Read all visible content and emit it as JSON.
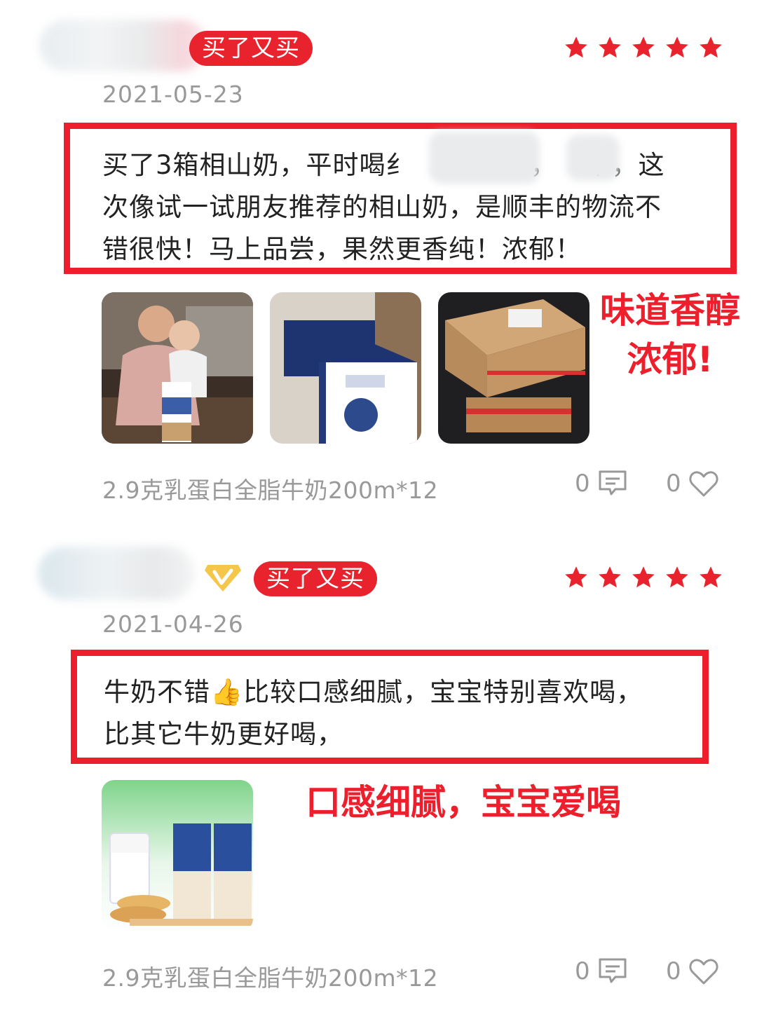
{
  "reviews": [
    {
      "badge": "买了又买",
      "rating": 5,
      "date": "2021-05-23",
      "text_lines": [
        "买了3箱相山奶，平时喝纟",
        "次像试一试朋友推荐的相山奶，是顺丰的物流不",
        "错很快！马上品尝，果然更香纯！浓郁！"
      ],
      "text_line1_mid": "利，",
      "text_line1_end": "丰，这",
      "callout_lines": [
        "味道香醇",
        "浓郁!"
      ],
      "images": [
        "grandma-and-baby-photo",
        "milk-gift-boxes-photo",
        "shipping-boxes-photo"
      ],
      "product": "2.9克乳蛋白全脂牛奶200m*12",
      "comment_count": "0",
      "like_count": "0"
    },
    {
      "badge": "买了又买",
      "rating": 5,
      "date": "2021-04-26",
      "text_lines": [
        "牛奶不错👍比较口感细腻，宝宝特别喜欢喝，",
        "比其它牛奶更好喝，"
      ],
      "callout_lines": [
        "口感细腻，宝宝爱喝"
      ],
      "images": [
        "milk-glass-and-cartons-photo"
      ],
      "product": "2.9克乳蛋白全脂牛奶200m*12",
      "comment_count": "0",
      "like_count": "0"
    }
  ],
  "colors": {
    "accent": "#ee1f2d",
    "star": "#e8232e",
    "muted": "#999999"
  },
  "icons": {
    "star": "star-icon",
    "comment": "comment-icon",
    "like": "heart-icon",
    "vip": "vip-diamond-icon"
  }
}
